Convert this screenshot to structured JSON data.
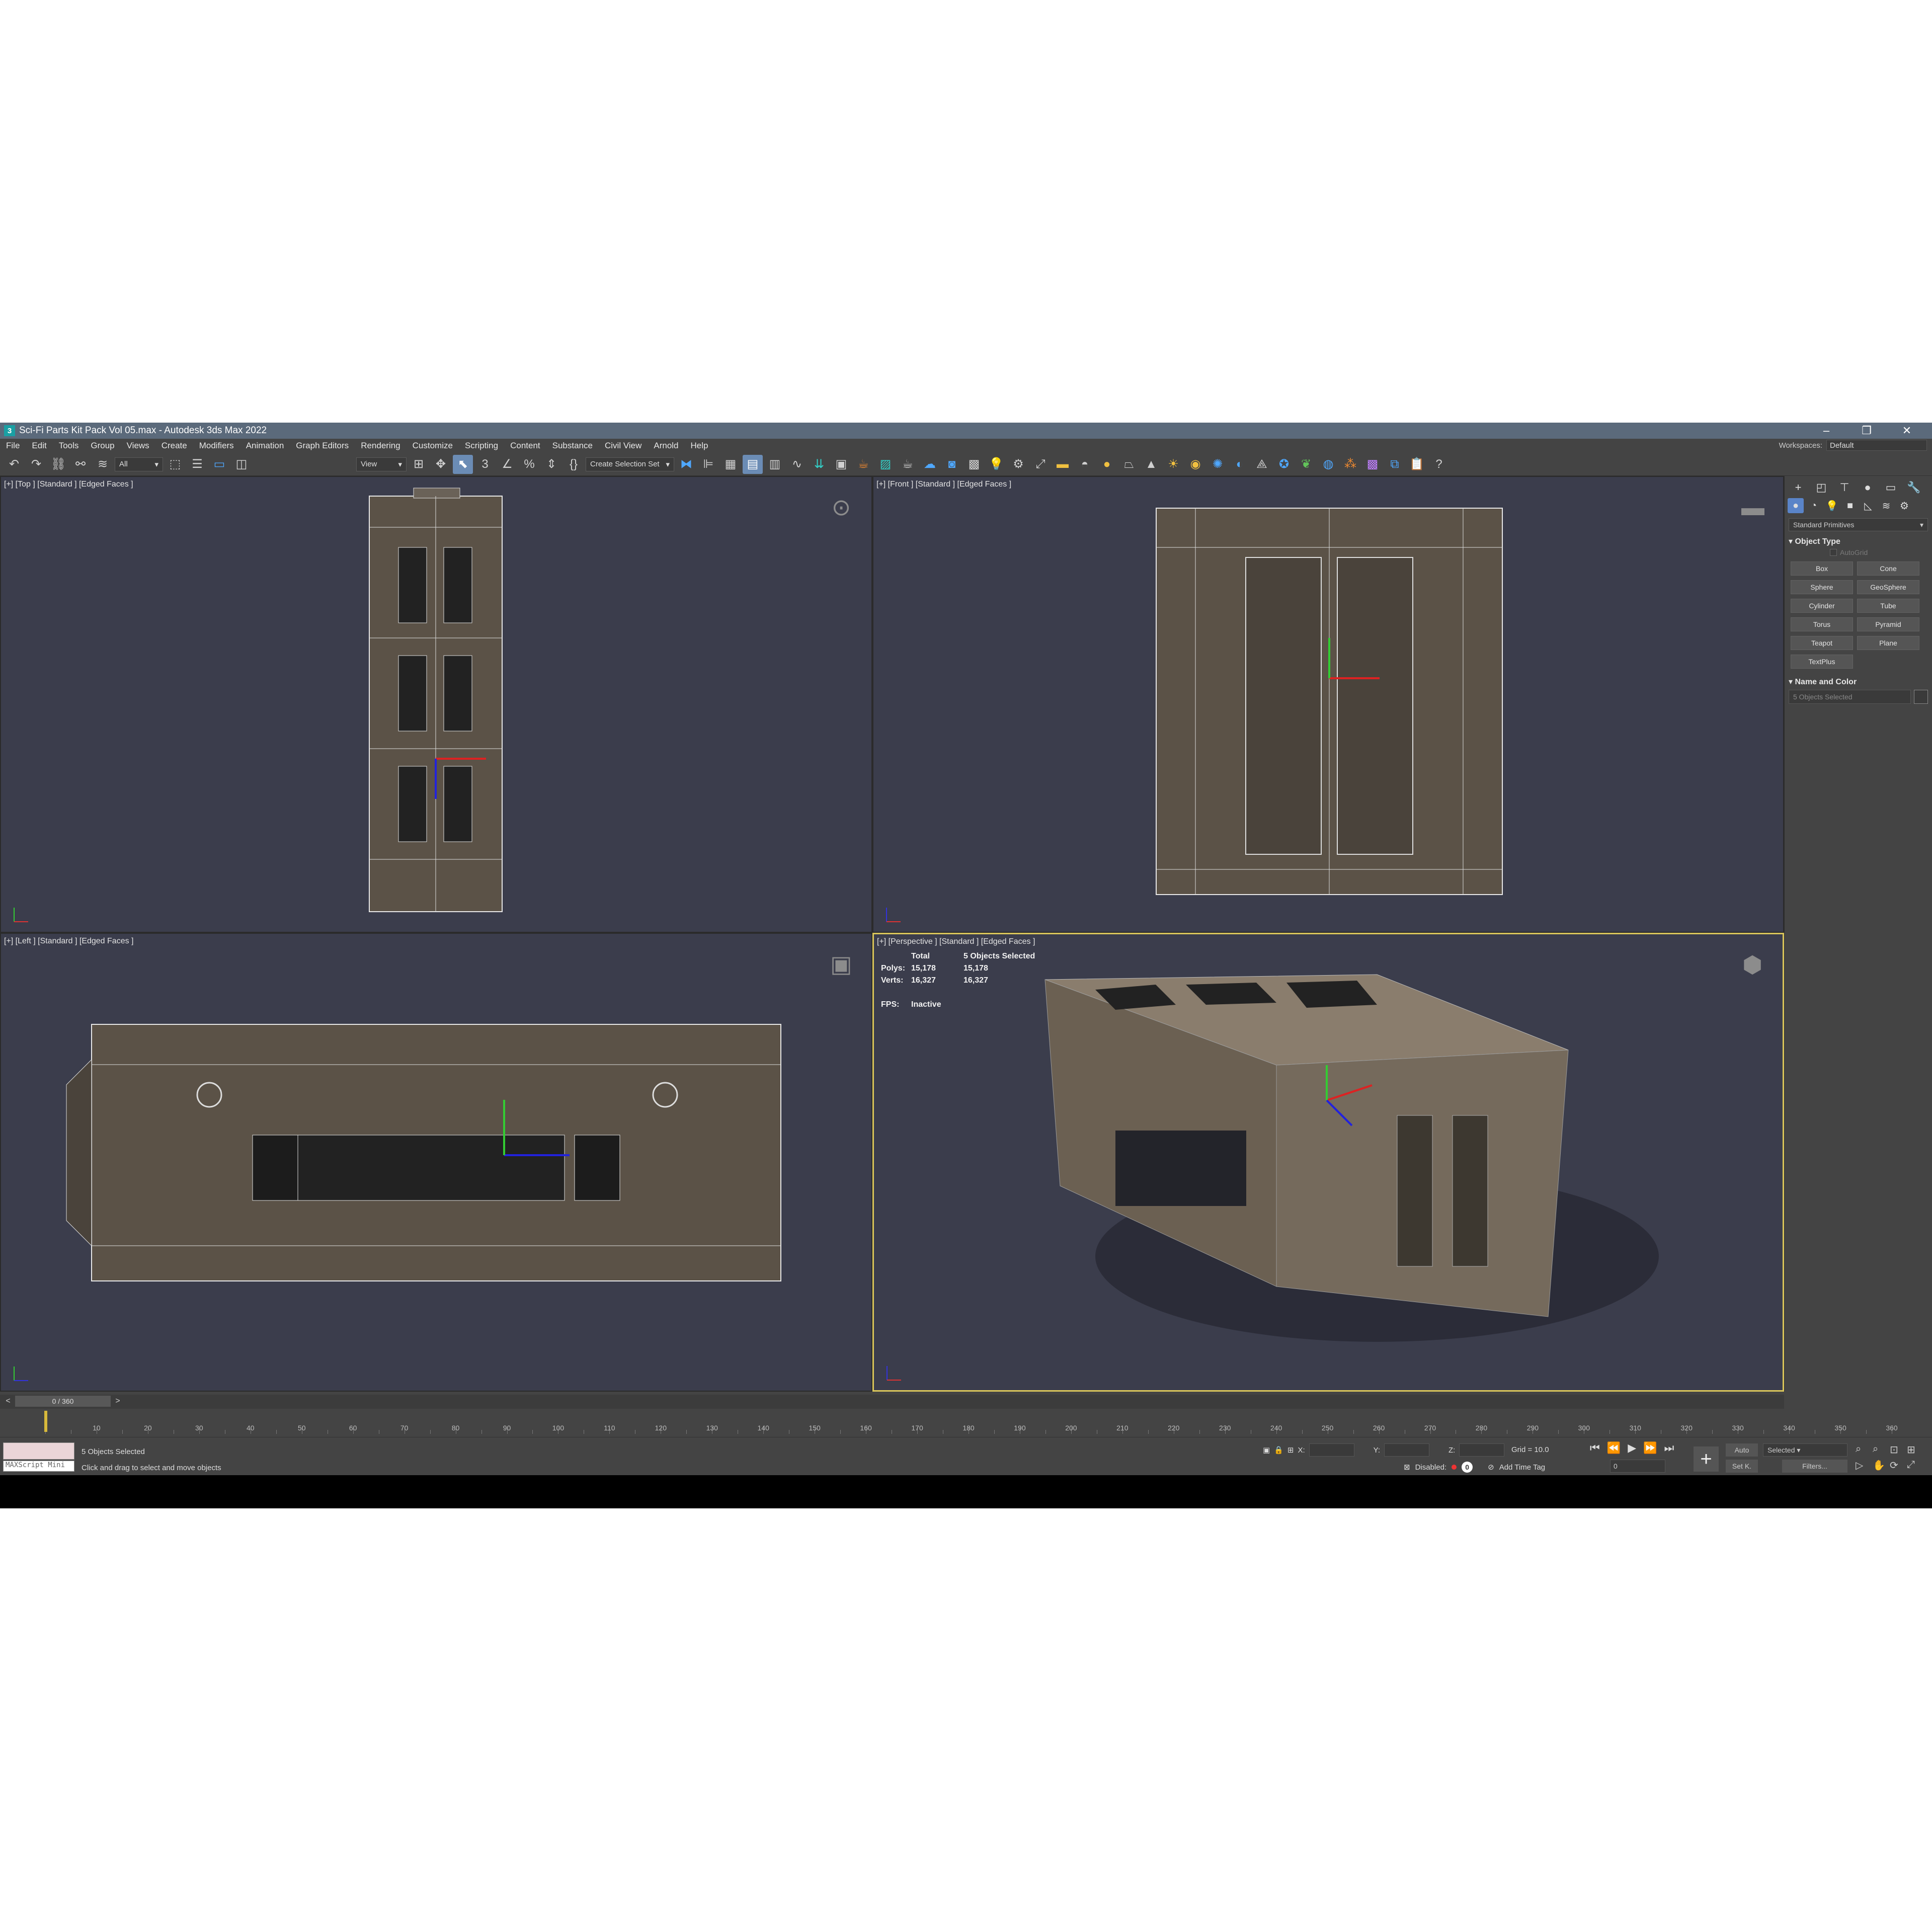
{
  "window": {
    "title": "Sci-Fi Parts Kit Pack Vol 05.max - Autodesk 3ds Max 2022",
    "app_icon": "3",
    "controls": [
      "–",
      "❐",
      "✕"
    ]
  },
  "menu": {
    "items": [
      "File",
      "Edit",
      "Tools",
      "Group",
      "Views",
      "Create",
      "Modifiers",
      "Animation",
      "Graph Editors",
      "Rendering",
      "Customize",
      "Scripting",
      "Content",
      "Substance",
      "Civil View",
      "Arnold",
      "Help"
    ],
    "workspaces_label": "Workspaces:",
    "workspaces_value": "Default"
  },
  "toolbar": {
    "selection_filter": "All",
    "ref_coord": "View",
    "selection_set": "Create Selection Set"
  },
  "viewports": {
    "top": {
      "label": "[+] [Top ] [Standard ] [Edged Faces ]"
    },
    "front": {
      "label": "[+] [Front ] [Standard ] [Edged Faces ]"
    },
    "left": {
      "label": "[+] [Left ] [Standard ] [Edged Faces ]"
    },
    "perspective": {
      "label": "[+] [Perspective ] [Standard ] [Edged Faces ]",
      "stats": {
        "header_total": "Total",
        "header_sel": "5 Objects Selected",
        "polys_label": "Polys:",
        "polys_total": "15,178",
        "polys_sel": "15,178",
        "verts_label": "Verts:",
        "verts_total": "16,327",
        "verts_sel": "16,327",
        "fps_label": "FPS:",
        "fps_value": "Inactive"
      }
    }
  },
  "command_panel": {
    "dropdown": "Standard Primitives",
    "object_type_title": "Object Type",
    "autogrid": "AutoGrid",
    "buttons": [
      "Box",
      "Cone",
      "Sphere",
      "GeoSphere",
      "Cylinder",
      "Tube",
      "Torus",
      "Pyramid",
      "Teapot",
      "Plane",
      "TextPlus"
    ],
    "name_color_title": "Name and Color",
    "name_value": "5 Objects Selected"
  },
  "timeline": {
    "slider": "0 / 360",
    "start": 0,
    "end": 360,
    "current": 0,
    "labels": [
      "10",
      "20",
      "30",
      "40",
      "50",
      "60",
      "70",
      "80",
      "90",
      "100",
      "110",
      "120",
      "130",
      "140",
      "150",
      "160",
      "170",
      "180",
      "190",
      "200",
      "210",
      "220",
      "230",
      "240",
      "250",
      "260",
      "270",
      "280",
      "290",
      "300",
      "310",
      "320",
      "330",
      "340",
      "350",
      "360"
    ]
  },
  "status": {
    "maxscript": "MAXScript Mini",
    "selected": "5 Objects Selected",
    "prompt": "Click and drag to select and move objects",
    "x_label": "X:",
    "y_label": "Y:",
    "z_label": "Z:",
    "grid": "Grid = 10.0",
    "disabled": "Disabled:",
    "disabled_value": "0",
    "add_time_tag": "Add Time Tag",
    "frame": "0",
    "auto": "Auto",
    "set_key": "Set K.",
    "selected_dd": "Selected",
    "filters": "Filters..."
  }
}
